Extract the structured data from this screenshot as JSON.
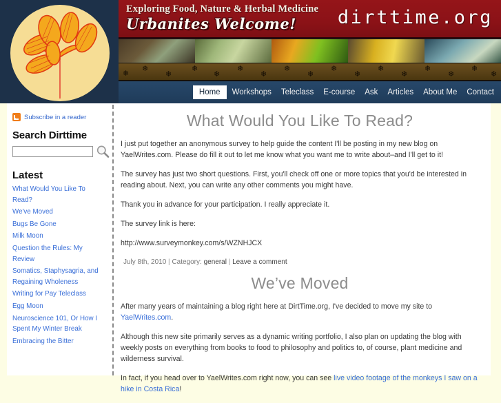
{
  "site": {
    "name": "dirttime.org",
    "tagline": "Exploring Food, Nature & Herbal Medicine",
    "welcome": "Urbanites Welcome!"
  },
  "nav": {
    "items": [
      {
        "label": "Home",
        "active": true
      },
      {
        "label": "Workshops",
        "active": false
      },
      {
        "label": "Teleclass",
        "active": false
      },
      {
        "label": "E-course",
        "active": false
      },
      {
        "label": "Ask",
        "active": false
      },
      {
        "label": "Articles",
        "active": false
      },
      {
        "label": "About Me",
        "active": false
      },
      {
        "label": "Contact",
        "active": false
      }
    ]
  },
  "sidebar": {
    "rss_label": "Subscribe in a reader",
    "search_heading": "Search Dirttime",
    "search_value": "",
    "search_placeholder": "",
    "latest_heading": "Latest",
    "latest": [
      "What Would You Like To Read?",
      "We've Moved",
      "Bugs Be Gone",
      "Milk Moon",
      "Question the Rules: My Review",
      "Somatics, Staphysagria, and Regaining Wholeness",
      "Writing for Pay Teleclass",
      "Egg Moon",
      "Neuroscience 101, Or How I Spent My Winter Break",
      "Embracing the Bitter"
    ]
  },
  "posts": [
    {
      "title": "What Would You Like To Read?",
      "paragraphs": [
        "I just put together an anonymous survey to help guide the content I'll be posting in my new blog on YaelWrites.com. Please do fill it out to let me know what you want me to write about–and I'll get to it!",
        "The survey has just two short questions. First, you'll check off one or more topics that you'd be interested in reading about. Next, you can write any other comments you might have.",
        "Thank you in advance for your participation. I really appreciate it.",
        "The survey link is here:",
        "http://www.surveymonkey.com/s/WZNHJCX"
      ],
      "meta": {
        "date": "July 8th, 2010",
        "category_label": "Category:",
        "category": "general",
        "comment_link": "Leave a comment"
      }
    },
    {
      "title": "We’ve Moved",
      "paragraphs": [
        "After many years of maintaining a blog right here at DirtTime.org, I've decided to move my site to YaelWrites.com.",
        "Although this new site primarily serves as a dynamic writing portfolio, I also plan on updating the blog with weekly posts on everything from books to food to philosophy and politics to, of course, plant medicine and wilderness survival.",
        "In fact, if you head over to YaelWrites.com right now, you can see live video footage of the monkeys I saw on a hike in Costa Rica!"
      ],
      "links": {
        "p1_link": "YaelWrites.com",
        "p3_link": "live video footage of the monkeys I saw on a hike in Costa Rica"
      }
    }
  ],
  "colors": {
    "banner_red": "#8f1418",
    "nav_navy": "#22405f",
    "logo_navy": "#1d3149",
    "logo_circle": "#f6dd95",
    "paw_band": "#5b4318",
    "link_blue": "#3a6fd8",
    "page_bg": "#fdfde4",
    "rss_orange": "#f07d1a"
  }
}
